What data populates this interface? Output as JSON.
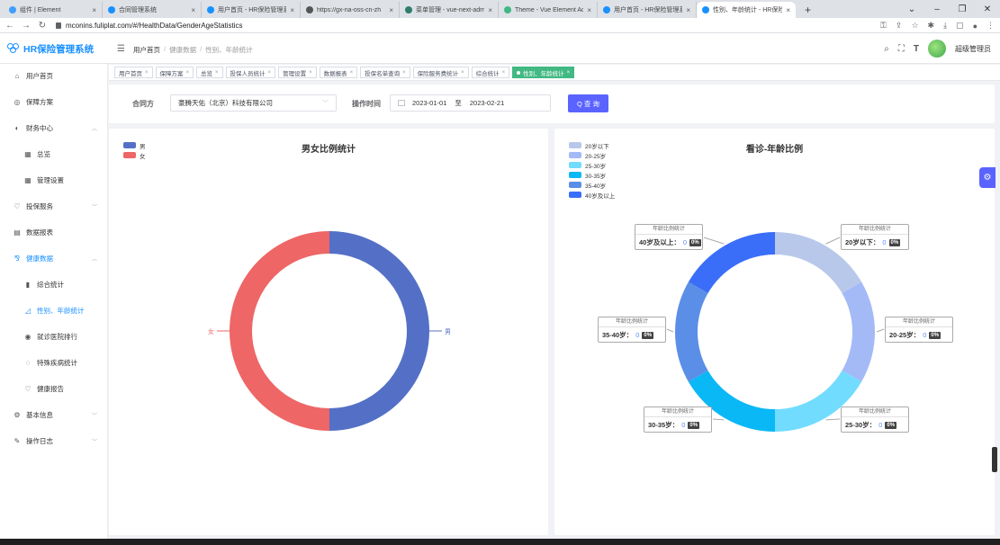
{
  "browser": {
    "tabs": [
      {
        "title": "组件 | Element",
        "color": "#409eff",
        "active": false
      },
      {
        "title": "合同管理系统",
        "color": "#1890ff",
        "active": false
      },
      {
        "title": "用户首页 - HR保险管理系",
        "color": "#1890ff",
        "active": false
      },
      {
        "title": "https://gx-na-oss-cn-zh",
        "color": "#555555",
        "active": false
      },
      {
        "title": "菜单管理 - vue-next-adm",
        "color": "#2e7d6b",
        "active": false
      },
      {
        "title": "Theme - Vue Element Ad",
        "color": "#41b883",
        "active": false
      },
      {
        "title": "用户首页 - HR保险管理系",
        "color": "#1890ff",
        "active": false
      },
      {
        "title": "性别、年龄统计 - HR保险",
        "color": "#1890ff",
        "active": true
      }
    ],
    "new_tab": "+",
    "url": "mconins.fuliplat.com/#/HealthData/GenderAgeStatistics"
  },
  "header": {
    "app_name": "HR保险管理系统",
    "breadcrumb": [
      "用户首页",
      "健康数据",
      "性别、年龄统计"
    ],
    "user_name": "超级管理员"
  },
  "sidebar": {
    "items": [
      {
        "label": "用户首页",
        "icon": "⌂"
      },
      {
        "label": "保障方案",
        "icon": "◎"
      },
      {
        "label": "财务中心",
        "icon": "◐"
      },
      {
        "label": "总览",
        "icon": "▦"
      },
      {
        "label": "管理设置",
        "icon": "▦"
      },
      {
        "label": "投保服务",
        "icon": "♡"
      },
      {
        "label": "数据报表",
        "icon": "▤"
      },
      {
        "label": "健康数据",
        "icon": "⅋"
      },
      {
        "label": "综合统计",
        "icon": "▮"
      },
      {
        "label": "性别、年龄统计",
        "icon": "◿"
      },
      {
        "label": "就诊医院排行",
        "icon": "◉"
      },
      {
        "label": "特殊疾病统计",
        "icon": "◌"
      },
      {
        "label": "健康报告",
        "icon": "♡"
      },
      {
        "label": "基本信息",
        "icon": "⚙"
      },
      {
        "label": "操作日志",
        "icon": "✎"
      }
    ]
  },
  "tags": [
    "用户首页",
    "保障方案",
    "总览",
    "投保人员统计",
    "管理设置",
    "数据报表",
    "投保名单查询",
    "保险服务费统计",
    "综合统计",
    "性别、年龄统计"
  ],
  "filter": {
    "contract_label": "合同方",
    "contract_value": "豪腾天佑（北京）科技有限公司",
    "time_label": "操作时间",
    "date_start": "2023-01-01",
    "date_sep": "至",
    "date_end": "2023-02-21",
    "search_button": "Q 查 询"
  },
  "gender_chart": {
    "title": "男女比例统计",
    "legend": [
      {
        "name": "男",
        "color": "#5470c6"
      },
      {
        "name": "女",
        "color": "#ee6666"
      }
    ],
    "label_male": "男",
    "label_female": "女"
  },
  "age_chart": {
    "title": "看诊-年龄比例",
    "legend": [
      {
        "name": "20岁以下",
        "color": "#b8c8ea"
      },
      {
        "name": "20-25岁",
        "color": "#a4baf7"
      },
      {
        "name": "25-30岁",
        "color": "#72dcff"
      },
      {
        "name": "30-35岁",
        "color": "#0ab8f5"
      },
      {
        "name": "35-40岁",
        "color": "#5b8ee6"
      },
      {
        "name": "40岁及以上",
        "color": "#3b6ef8"
      }
    ],
    "box_title": "年龄比例统计",
    "boxes": [
      {
        "label": "40岁及以上：",
        "value": "0",
        "pct": "0%"
      },
      {
        "label": "20岁以下：",
        "value": "0",
        "pct": "0%"
      },
      {
        "label": "35-40岁：",
        "value": "0",
        "pct": "0%"
      },
      {
        "label": "20-25岁：",
        "value": "0",
        "pct": "0%"
      },
      {
        "label": "30-35岁：",
        "value": "0",
        "pct": "0%"
      },
      {
        "label": "25-30岁：",
        "value": "0",
        "pct": "0%"
      }
    ]
  },
  "chart_data": [
    {
      "type": "pie",
      "title": "男女比例统计",
      "categories": [
        "男",
        "女"
      ],
      "values": [
        50,
        50
      ],
      "legend": "top-left"
    },
    {
      "type": "pie",
      "title": "看诊-年龄比例",
      "categories": [
        "20岁以下",
        "20-25岁",
        "25-30岁",
        "30-35岁",
        "35-40岁",
        "40岁及以上"
      ],
      "values": [
        0,
        0,
        0,
        0,
        0,
        0
      ],
      "legend": "top-left"
    }
  ]
}
